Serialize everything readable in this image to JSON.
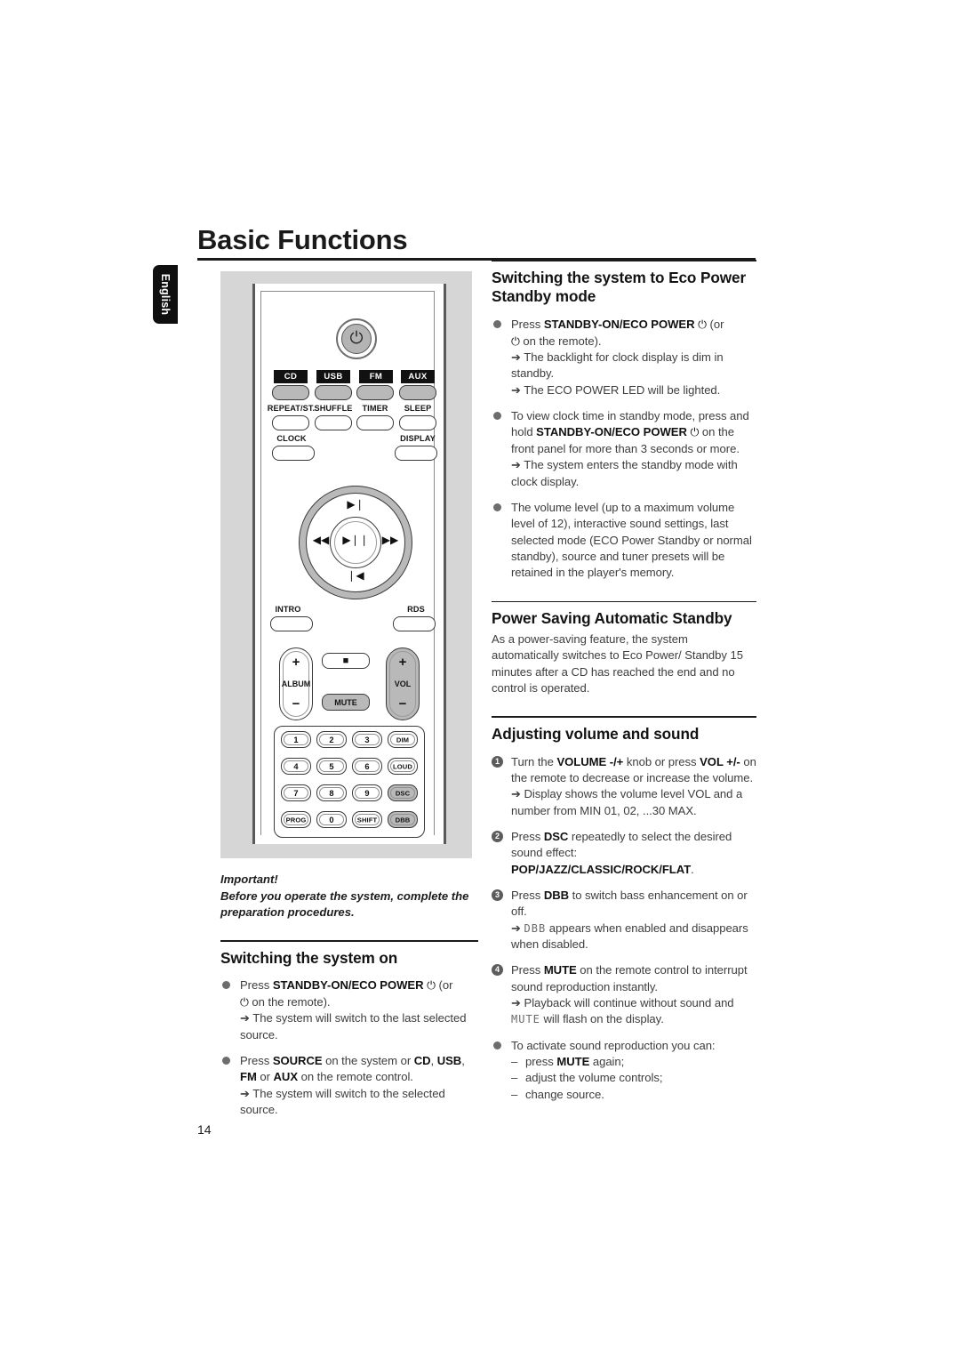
{
  "page": {
    "title": "Basic Functions",
    "language_tab": "English",
    "page_number": "14"
  },
  "remote": {
    "power_icon": "power-icon",
    "source_labels": [
      "CD",
      "USB",
      "FM",
      "AUX"
    ],
    "row1_captions": [
      "REPEAT/ST.",
      "SHUFFLE",
      "TIMER",
      "SLEEP"
    ],
    "row2_captions": [
      "CLOCK",
      "DISPLAY"
    ],
    "nav": {
      "up": "▶❘",
      "left": "◀◀",
      "center": "▶❘❘",
      "right": "▶▶",
      "down": "❘◀"
    },
    "intro_label": "INTRO",
    "rds_label": "RDS",
    "album_label": "ALBUM",
    "vol_label": "VOL",
    "plus": "+",
    "minus": "−",
    "stop_label": "■",
    "mute_label": "MUTE",
    "keypad": [
      [
        "1",
        "2",
        "3",
        "DIM"
      ],
      [
        "4",
        "5",
        "6",
        "LOUD"
      ],
      [
        "7",
        "8",
        "9",
        "DSC"
      ],
      [
        "PROG",
        "0",
        "SHIFT",
        "DBB"
      ]
    ]
  },
  "left_column": {
    "important_title": "Important!",
    "important_body": "Before you operate the system, complete the preparation procedures.",
    "section_title": "Switching the system on",
    "items": [
      {
        "type": "bullet",
        "lines": [
          "Press STANDBY-ON/ECO POWER ⏻ (or ⏻ on the remote).",
          "→ The system will switch to the last selected source."
        ],
        "text_a": "Press ",
        "bold_a": "STANDBY-ON/ECO POWER",
        "text_b": " (or",
        "text_c": " on the remote).",
        "arrow1": "The system will switch to the last selected source."
      },
      {
        "type": "bullet",
        "text_a": "Press ",
        "bold_a": "SOURCE",
        "text_b": " on the system or ",
        "bold_b": "CD",
        "text_c": ", ",
        "bold_c": "USB",
        "text_d": ", ",
        "bold_d": "FM",
        "text_e": " or ",
        "bold_e": "AUX",
        "text_f": " on the remote control.",
        "arrow1": "The system will switch to the selected source."
      }
    ]
  },
  "right_column": {
    "section1": {
      "title": "Switching the system to Eco Power Standby mode",
      "item1": {
        "text_a": "Press ",
        "bold_a": "STANDBY-ON/ECO POWER",
        "text_b": " (or",
        "text_c": " on the remote).",
        "arrow1": "The backlight for clock display is dim in standby.",
        "arrow2": "The ECO POWER LED will be lighted."
      },
      "item2": {
        "text_a": "To view clock time in standby mode, press and hold ",
        "bold_a": "STANDBY-ON/ECO POWER",
        "text_b": " on the front panel for more than 3 seconds or more.",
        "arrow1": "The system enters the standby mode with clock display."
      },
      "item3": {
        "text": "The volume level (up to a maximum volume level of 12), interactive sound settings, last selected mode (ECO Power  Standby or normal standby), source and tuner presets will be retained in the player's memory."
      }
    },
    "section2": {
      "title": "Power Saving Automatic Standby",
      "body": "As a power-saving feature, the system automatically switches to Eco Power/ Standby 15 minutes after a CD has reached the end and no control is operated."
    },
    "section3": {
      "title": "Adjusting volume and sound",
      "item1": {
        "num": "1",
        "text_a": "Turn the ",
        "bold_a": "VOLUME -/+",
        "text_b": " knob or press ",
        "bold_b": "VOL +/-",
        "text_c": " on the remote to decrease or increase the volume.",
        "arrow1": "Display shows the volume level VOL and a number from MIN 01, 02, ...30 MAX."
      },
      "item2": {
        "num": "2",
        "text_a": "Press ",
        "bold_a": "DSC",
        "text_b": " repeatedly to select the desired sound effect: ",
        "bold_b": "POP/JAZZ/CLASSIC/ROCK/FLAT",
        "text_c": "."
      },
      "item3": {
        "num": "3",
        "text_a": "Press ",
        "bold_a": "DBB",
        "text_b": " to switch bass enhancement on or off.",
        "lcd": "DBB",
        "arrow1_rest": " appears when enabled and disappears when disabled."
      },
      "item4": {
        "num": "4",
        "text_a": "Press ",
        "bold_a": "MUTE",
        "text_b": " on the remote control to interrupt sound reproduction instantly.",
        "arrow1_pre": "Playback will continue without sound and ",
        "lcd": "MUTE",
        "arrow1_rest": " will flash on the display."
      },
      "item5": {
        "text": "To activate sound reproduction you can:",
        "sub1_pre": "press ",
        "sub1_bold": "MUTE",
        "sub1_post": " again;",
        "sub2": "adjust the volume controls;",
        "sub3": "change source.",
        "dash": "–"
      }
    }
  }
}
